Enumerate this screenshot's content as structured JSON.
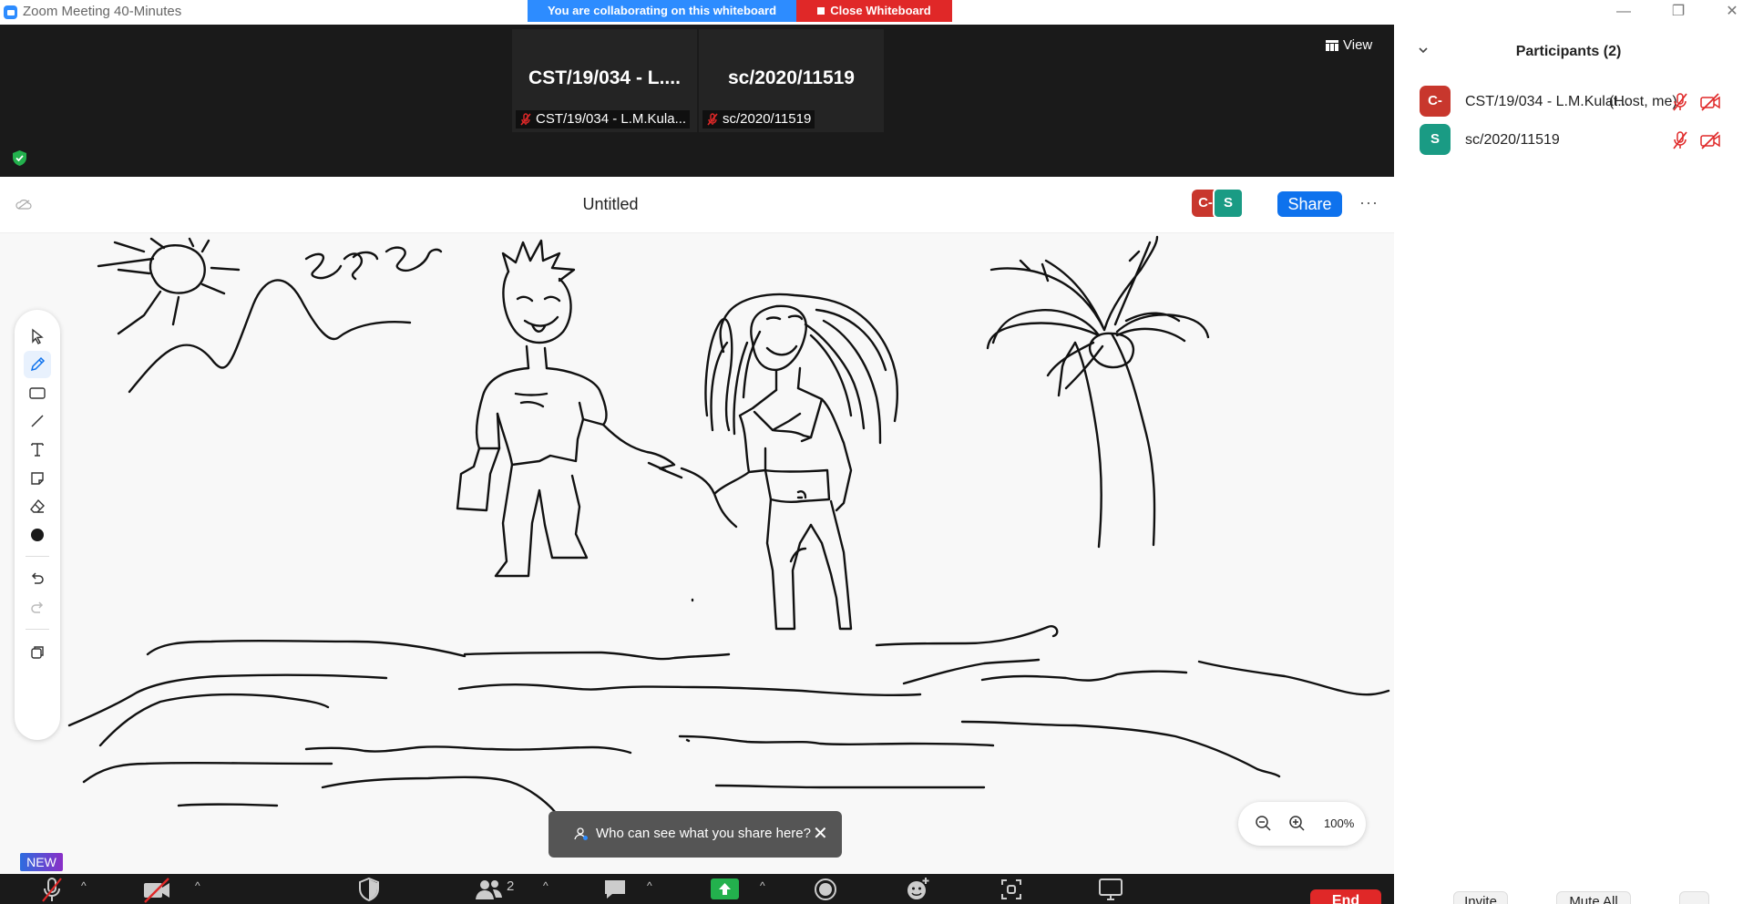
{
  "window": {
    "title": "Zoom Meeting 40-Minutes",
    "collab_banner": "You are collaborating on this whiteboard",
    "close_whiteboard": "Close Whiteboard"
  },
  "video": {
    "tiles": [
      {
        "display_name": "CST/19/034 - L....",
        "label": "CST/19/034 - L.M.Kula..."
      },
      {
        "display_name": "sc/2020/11519",
        "label": "sc/2020/11519"
      }
    ],
    "view_label": "View"
  },
  "whiteboard": {
    "title": "Untitled",
    "collaborators": [
      {
        "initial": "C-",
        "color": "#c8372d"
      },
      {
        "initial": "S",
        "color": "#1a9b84"
      }
    ],
    "share_label": "Share",
    "more_label": "···",
    "tools": [
      "select-icon",
      "pen-icon",
      "rectangle-icon",
      "line-icon",
      "text-icon",
      "sticky-note-icon",
      "eraser-icon",
      "color-icon",
      "undo-icon",
      "redo-icon",
      "layers-icon"
    ],
    "zoom_pct": "100%",
    "toast_text": "Who can see what you share here?",
    "new_badge": "NEW"
  },
  "controls": {
    "participants_count": "2",
    "end_label": "End"
  },
  "participants_panel": {
    "title": "Participants (2)",
    "participants": [
      {
        "initial": "C-",
        "name": "CST/19/034 - L.M.Kulat...",
        "role": "(Host, me)",
        "color": "#c8372d"
      },
      {
        "initial": "S",
        "name": "sc/2020/11519",
        "role": "",
        "color": "#1a9b84"
      }
    ],
    "invite_label": "Invite",
    "mute_all_label": "Mute All",
    "more_label": "..."
  },
  "colors": {
    "accent_blue": "#0e72ed",
    "end_red": "#e02828",
    "video_bg": "#1a1a1a"
  }
}
